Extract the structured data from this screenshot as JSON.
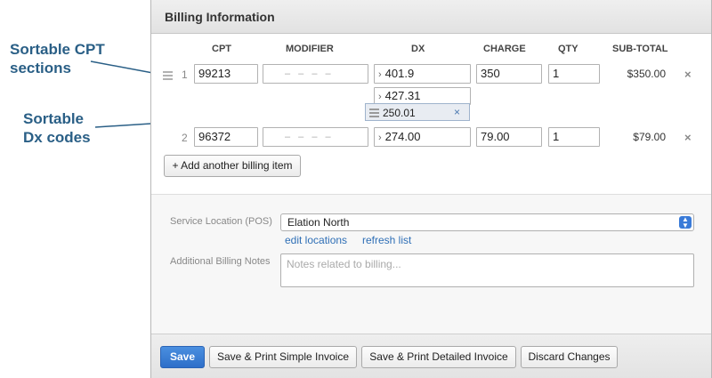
{
  "annotations": {
    "sortable_cpt_line1": "Sortable CPT",
    "sortable_cpt_line2": "sections",
    "sortable_dx_line1": "Sortable",
    "sortable_dx_line2": "Dx codes"
  },
  "panel": {
    "title": "Billing Information"
  },
  "columns": {
    "cpt": "CPT",
    "modifier": "MODIFIER",
    "dx": "DX",
    "charge": "CHARGE",
    "qty": "QTY",
    "subtotal": "SUB-TOTAL"
  },
  "rows": [
    {
      "num": "1",
      "cpt": "99213",
      "modifier_placeholder": "– – – –",
      "dx": [
        "401.9",
        "427.31"
      ],
      "dragging_dx": "250.01",
      "charge": "350",
      "qty": "1",
      "subtotal": "$350.00"
    },
    {
      "num": "2",
      "cpt": "96372",
      "modifier_placeholder": "– – – –",
      "dx": [
        "274.00"
      ],
      "charge": "79.00",
      "qty": "1",
      "subtotal": "$79.00"
    }
  ],
  "icons": {
    "chevron": "›",
    "remove": "×"
  },
  "add_item_label": "+ Add another billing item",
  "service_location": {
    "label": "Service Location (POS)",
    "value": "Elation North",
    "edit_link": "edit locations",
    "refresh_link": "refresh list"
  },
  "notes": {
    "label": "Additional Billing Notes",
    "placeholder": "Notes related to billing..."
  },
  "footer": {
    "save": "Save",
    "print_simple": "Save & Print Simple Invoice",
    "print_detailed": "Save & Print Detailed Invoice",
    "discard": "Discard Changes"
  },
  "colors": {
    "annotation": "#2a5f86",
    "primary": "#2e6fc9",
    "link": "#2f6fb6"
  }
}
